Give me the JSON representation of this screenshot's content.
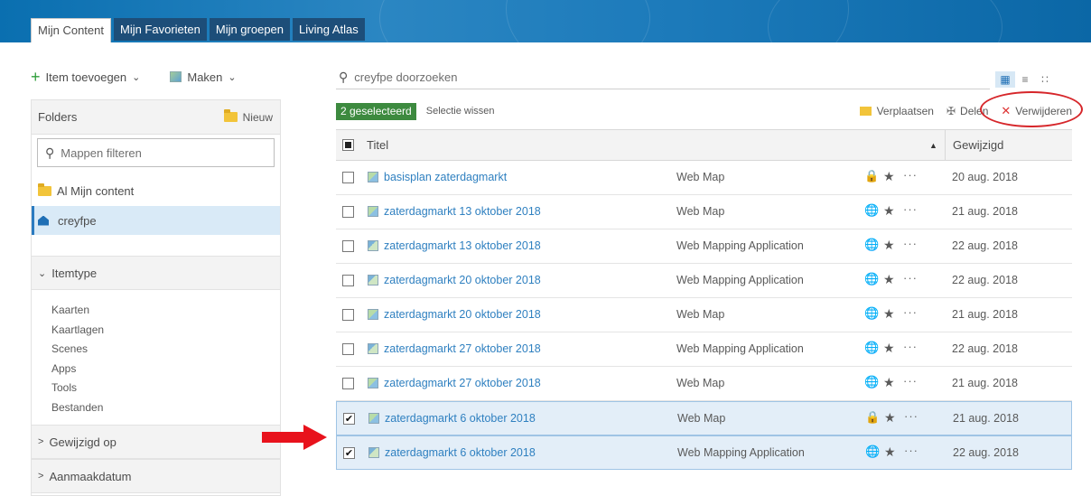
{
  "tabs": [
    "Mijn Content",
    "Mijn Favorieten",
    "Mijn groepen",
    "Living Atlas"
  ],
  "toolbar": {
    "add_item": "Item toevoegen",
    "create": "Maken"
  },
  "folders": {
    "heading": "Folders",
    "new_label": "Nieuw",
    "filter_placeholder": "Mappen filteren",
    "items": [
      "Al Mijn content",
      "creyfpe"
    ]
  },
  "filters": {
    "itemtype_label": "Itemtype",
    "types": [
      "Kaarten",
      "Kaartlagen",
      "Scenes",
      "Apps",
      "Tools",
      "Bestanden"
    ],
    "modified_label": "Gewijzigd op",
    "created_label": "Aanmaakdatum"
  },
  "search": {
    "placeholder": "creyfpe doorzoeken"
  },
  "selection": {
    "badge": "2 geselecteerd",
    "clear": "Selectie wissen",
    "move": "Verplaatsen",
    "share": "Delen",
    "delete": "Verwijderen"
  },
  "table": {
    "col_title": "Titel",
    "col_modified": "Gewijzigd",
    "rows": [
      {
        "title": "basisplan zaterdagmarkt",
        "type": "Web Map",
        "date": "20 aug. 2018",
        "checked": false,
        "sharing": "private"
      },
      {
        "title": "zaterdagmarkt 13 oktober 2018",
        "type": "Web Map",
        "date": "21 aug. 2018",
        "checked": false,
        "sharing": "public"
      },
      {
        "title": "zaterdagmarkt 13 oktober 2018",
        "type": "Web Mapping Application",
        "date": "22 aug. 2018",
        "checked": false,
        "sharing": "public"
      },
      {
        "title": "zaterdagmarkt 20 oktober 2018",
        "type": "Web Mapping Application",
        "date": "22 aug. 2018",
        "checked": false,
        "sharing": "public"
      },
      {
        "title": "zaterdagmarkt 20 oktober 2018",
        "type": "Web Map",
        "date": "21 aug. 2018",
        "checked": false,
        "sharing": "public"
      },
      {
        "title": "zaterdagmarkt 27 oktober 2018",
        "type": "Web Mapping Application",
        "date": "22 aug. 2018",
        "checked": false,
        "sharing": "public"
      },
      {
        "title": "zaterdagmarkt 27 oktober 2018",
        "type": "Web Map",
        "date": "21 aug. 2018",
        "checked": false,
        "sharing": "public"
      },
      {
        "title": "zaterdagmarkt 6 oktober 2018",
        "type": "Web Map",
        "date": "21 aug. 2018",
        "checked": true,
        "sharing": "private"
      },
      {
        "title": "zaterdagmarkt 6 oktober 2018",
        "type": "Web Mapping Application",
        "date": "22 aug. 2018",
        "checked": true,
        "sharing": "public"
      }
    ]
  },
  "colors": {
    "accent": "#2f80c0",
    "selected_badge": "#3d8a3f",
    "annotation_red": "#d6262a",
    "banner": "#1d7bbb"
  }
}
